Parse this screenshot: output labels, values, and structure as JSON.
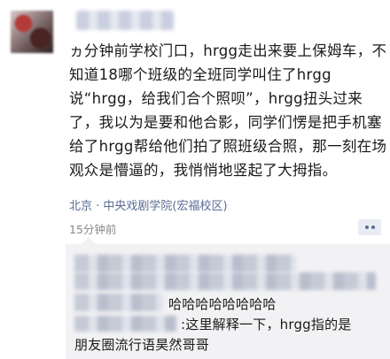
{
  "post": {
    "text": "ヵ分钟前学校门口，hrgg走出来要上保姆车，不知道18哪个班级的全班同学叫住了hrgg说“hrgg，给我们合个照呗”，hrgg扭头过来了，我以为是要和他合影，同学们愣是把手机塞给了hrgg帮给他们拍了照班级合照，那一刻在场观众是懵逼的，我悄悄地竖起了大拇指。",
    "location": "北京 · 中央戏剧学院(宏福校区)",
    "time": "15分钟前",
    "menu_icon": "more-dots-icon"
  },
  "comments": [
    {
      "text": "哈哈哈哈哈哈哈哈"
    },
    {
      "text": ":这里解释一下，hrgg指的是"
    },
    {
      "text": "朋友圈流行语昊然哥哥"
    }
  ],
  "colors": {
    "link_blue": "#5a6c95",
    "text": "#1a1a1a",
    "muted": "#888888",
    "comment_bg": "#f2f2f4"
  }
}
